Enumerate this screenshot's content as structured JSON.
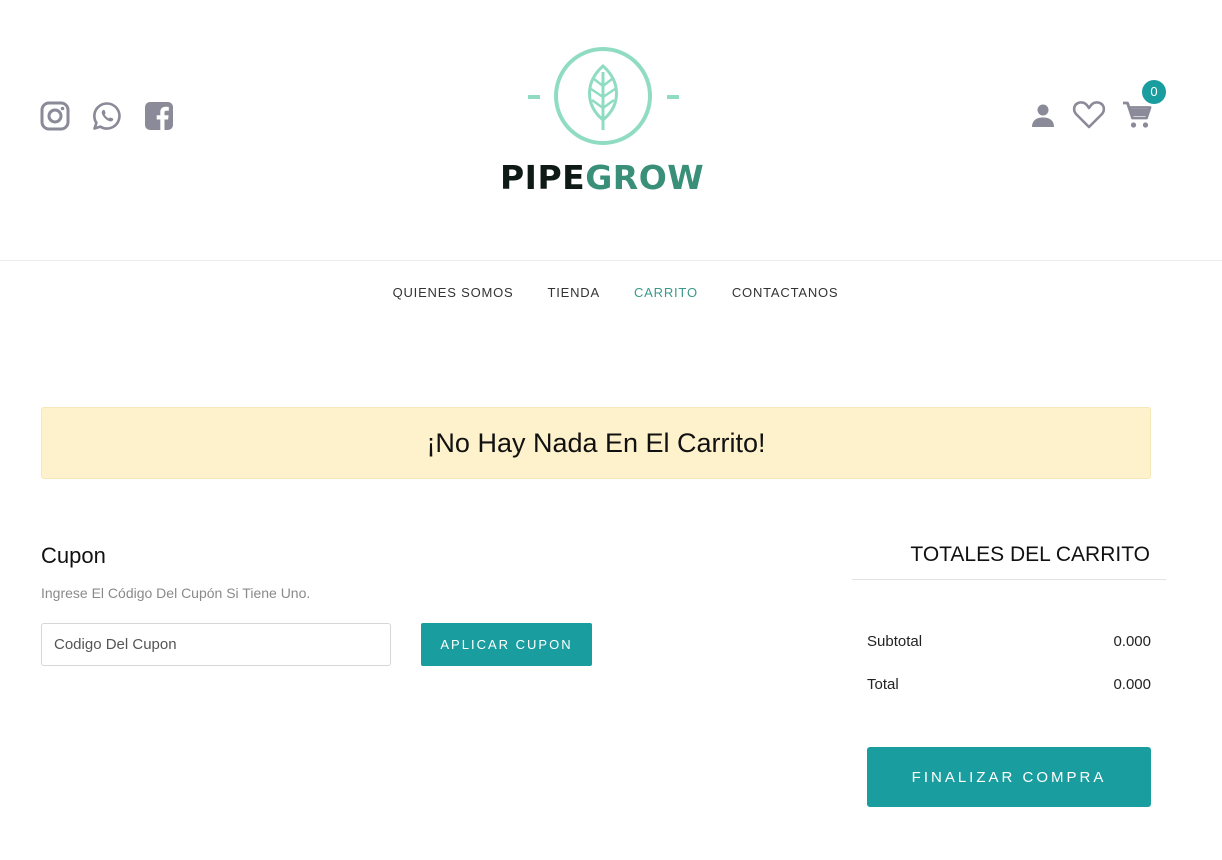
{
  "brand": {
    "part1": "PIPE",
    "part2": "GROW"
  },
  "social": {
    "icons": [
      "instagram-icon",
      "whatsapp-icon",
      "facebook-icon"
    ]
  },
  "account": {
    "icons": [
      "user-icon",
      "heart-icon",
      "cart-icon"
    ],
    "cart_count": "0"
  },
  "nav": {
    "items": [
      {
        "label": "QUIENES SOMOS",
        "active": false
      },
      {
        "label": "TIENDA",
        "active": false
      },
      {
        "label": "CARRITO",
        "active": true
      },
      {
        "label": "CONTACTANOS",
        "active": false
      }
    ]
  },
  "notice": {
    "text": "¡No Hay Nada En El Carrito!"
  },
  "coupon": {
    "title": "Cupon",
    "hint": "Ingrese El Código Del Cupón Si Tiene Uno.",
    "placeholder": "Codigo Del Cupon",
    "value": "",
    "button_label": "APLICAR CUPON"
  },
  "totals": {
    "title": "TOTALES DEL CARRITO",
    "subtotal_label": "Subtotal",
    "subtotal_value": "0.000",
    "total_label": "Total",
    "total_value": "0.000",
    "checkout_label": "FINALIZAR COMPRA"
  },
  "colors": {
    "accent": "#1a9d9f",
    "logo_light": "#8fdcc3",
    "logo_dark": "#0f1a17",
    "logo_green": "#3a8f79",
    "icon_gray": "#8a8a99",
    "notice_bg": "#fef2cc"
  }
}
